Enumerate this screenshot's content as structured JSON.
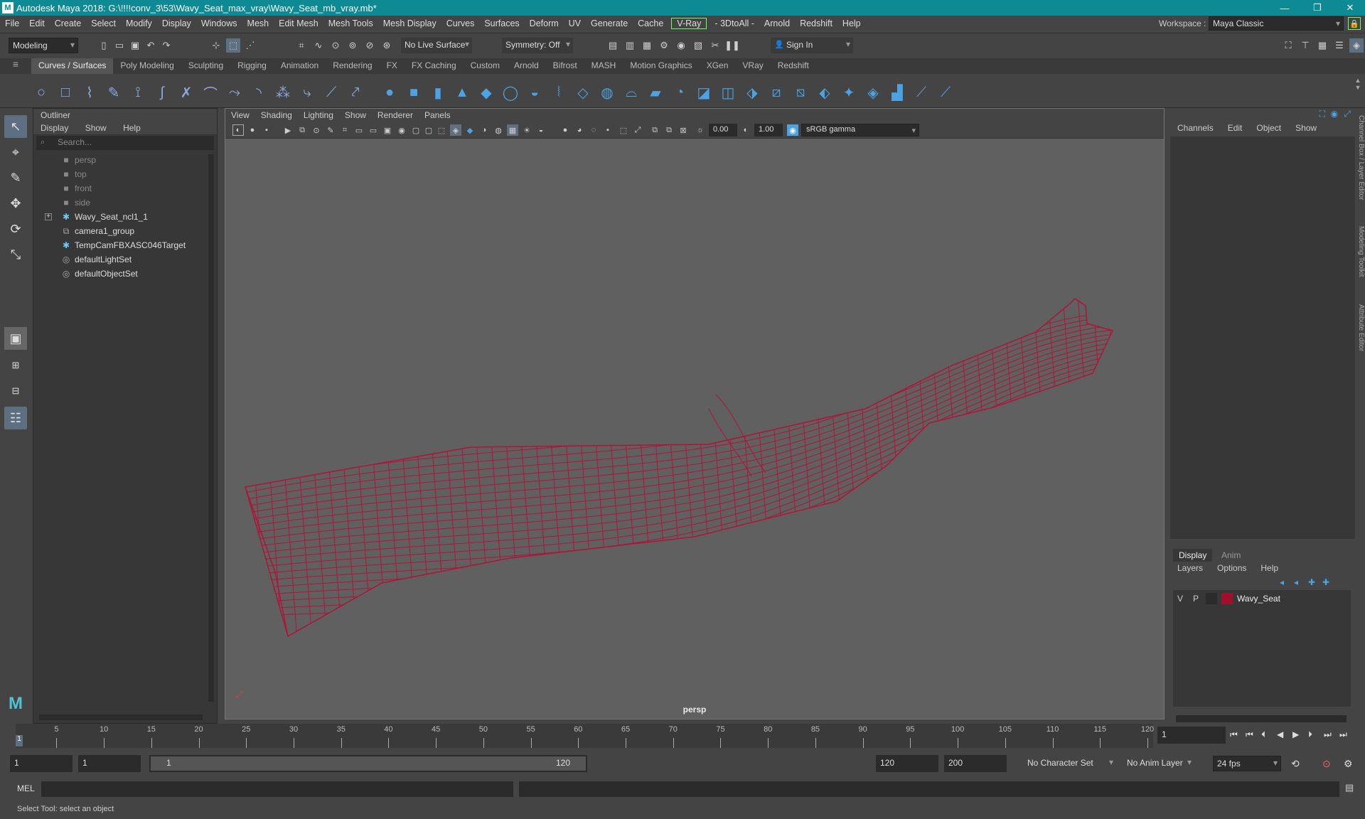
{
  "title": "Autodesk Maya 2018: G:\\!!!!conv_3\\53\\Wavy_Seat_max_vray\\Wavy_Seat_mb_vray.mb*",
  "menus": [
    "File",
    "Edit",
    "Create",
    "Select",
    "Modify",
    "Display",
    "Windows",
    "Mesh",
    "Edit Mesh",
    "Mesh Tools",
    "Mesh Display",
    "Curves",
    "Surfaces",
    "Deform",
    "UV",
    "Generate",
    "Cache"
  ],
  "menus2": [
    "- 3DtoAll -",
    "Arnold",
    "Redshift",
    "Help"
  ],
  "vray_label": "V-Ray",
  "workspace_label": "Workspace :",
  "workspace_value": "Maya Classic",
  "mode_value": "Modeling",
  "live_surface": "No Live Surface",
  "symmetry": "Symmetry: Off",
  "sign_in": "Sign In",
  "shelf_tabs": [
    "Curves / Surfaces",
    "Poly Modeling",
    "Sculpting",
    "Rigging",
    "Animation",
    "Rendering",
    "FX",
    "FX Caching",
    "Custom",
    "Arnold",
    "Bifrost",
    "MASH",
    "Motion Graphics",
    "XGen",
    "VRay",
    "Redshift"
  ],
  "outliner": {
    "title": "Outliner",
    "menu": [
      "Display",
      "Show",
      "Help"
    ],
    "search_placeholder": "Search...",
    "items": [
      {
        "label": "persp",
        "icon": "camera-icon",
        "dim": true
      },
      {
        "label": "top",
        "icon": "camera-icon",
        "dim": true
      },
      {
        "label": "front",
        "icon": "camera-icon",
        "dim": true
      },
      {
        "label": "side",
        "icon": "camera-icon",
        "dim": true
      },
      {
        "label": "Wavy_Seat_ncl1_1",
        "icon": "mesh-group-icon",
        "dim": false
      },
      {
        "label": "camera1_group",
        "icon": "group-icon",
        "dim": false
      },
      {
        "label": "TempCamFBXASC046Target",
        "icon": "locator-icon",
        "dim": false
      },
      {
        "label": "defaultLightSet",
        "icon": "set-icon",
        "dim": false
      },
      {
        "label": "defaultObjectSet",
        "icon": "set-icon",
        "dim": false
      }
    ]
  },
  "viewport": {
    "menu": [
      "View",
      "Shading",
      "Lighting",
      "Show",
      "Renderer",
      "Panels"
    ],
    "exposure": "0.00",
    "gamma": "1.00",
    "colorspace": "sRGB gamma",
    "camera": "persp"
  },
  "channel_box": {
    "menu": [
      "Channels",
      "Edit",
      "Object",
      "Show"
    ]
  },
  "layer_editor": {
    "tabs": [
      "Display",
      "Anim"
    ],
    "menu": [
      "Layers",
      "Options",
      "Help"
    ],
    "layer": {
      "v": "V",
      "p": "P",
      "name": "Wavy_Seat",
      "color": "#a0102e"
    }
  },
  "side_tabs": [
    "Channel Box / Layer Editor",
    "Modeling Toolkit",
    "Attribute Editor"
  ],
  "timeline": {
    "ticks": [
      "5",
      "10",
      "15",
      "20",
      "25",
      "30",
      "35",
      "40",
      "45",
      "50",
      "55",
      "60",
      "65",
      "70",
      "75",
      "80",
      "85",
      "90",
      "95",
      "100",
      "105",
      "110",
      "115",
      "120"
    ],
    "current_frame": "1",
    "start_marker": "1"
  },
  "range": {
    "start": "1",
    "start2": "1",
    "slider_start": "1",
    "slider_end": "120",
    "end": "120",
    "end2": "200",
    "character_set": "No Character Set",
    "anim_layer": "No Anim Layer",
    "fps": "24 fps"
  },
  "cmd": {
    "label": "MEL"
  },
  "help_text": "Select Tool: select an object",
  "colors": {
    "titlebar": "#0e8a94",
    "wire": "#b0143a",
    "selected_tool": "#5d6f80"
  }
}
